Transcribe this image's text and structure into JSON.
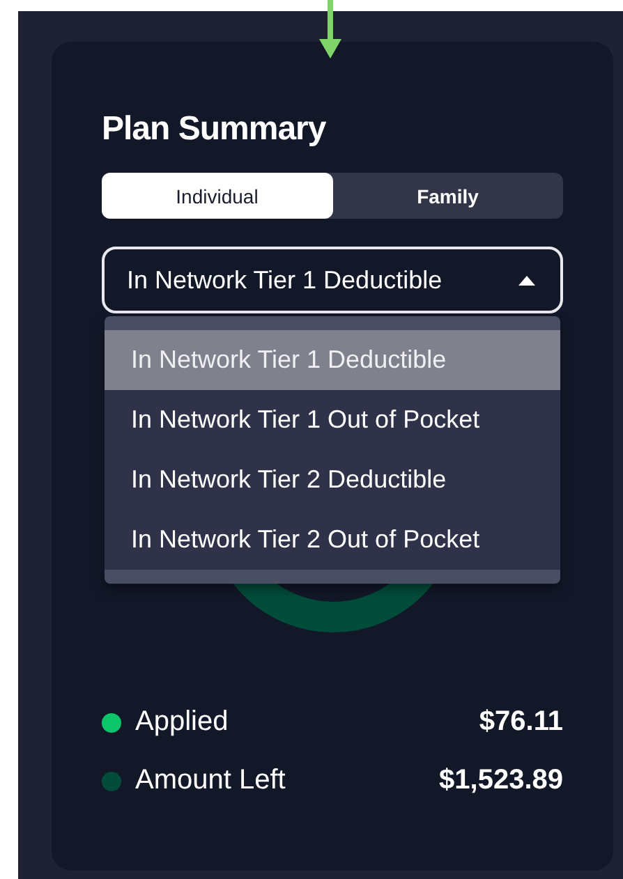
{
  "title": "Plan Summary",
  "coverage_toggle": [
    {
      "label": "Individual",
      "selected": true
    },
    {
      "label": "Family",
      "selected": false
    }
  ],
  "plan_select": {
    "value": "In Network Tier 1 Deductible",
    "expanded": true,
    "options": [
      {
        "label": "In Network Tier 1 Deductible",
        "selected": true
      },
      {
        "label": "In Network Tier 1 Out of Pocket",
        "selected": false
      },
      {
        "label": "In Network Tier 2 Deductible",
        "selected": false
      },
      {
        "label": "In Network Tier 2 Out of Pocket",
        "selected": false
      }
    ]
  },
  "legend": [
    {
      "label": "Applied",
      "amount": "$76.11",
      "color": "#0cc46a"
    },
    {
      "label": "Amount Left",
      "amount": "$1,523.89",
      "color": "#024d3a"
    }
  ]
}
